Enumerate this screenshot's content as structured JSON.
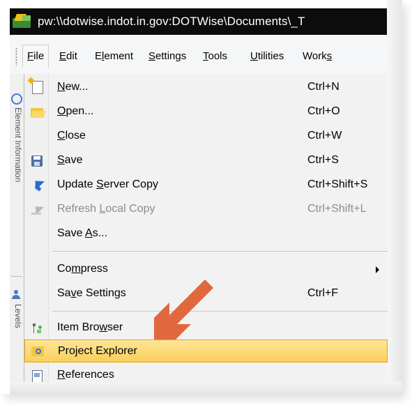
{
  "window": {
    "title": "pw:\\\\dotwise.indot.in.gov:DOTWise\\Documents\\_T"
  },
  "menubar": {
    "items": [
      {
        "label": "File",
        "mnemonic_index": 0
      },
      {
        "label": "Edit",
        "mnemonic_index": 0
      },
      {
        "label": "Element",
        "mnemonic_index": 1
      },
      {
        "label": "Settings",
        "mnemonic_index": 0
      },
      {
        "label": "Tools",
        "mnemonic_index": 0
      },
      {
        "label": "Utilities",
        "mnemonic_index": 0
      },
      {
        "label": "Works",
        "mnemonic_index": 4
      }
    ],
    "active": "File"
  },
  "sidepanel": {
    "text_top": "Element Information",
    "text_bottom": "Levels"
  },
  "file_menu": {
    "items": [
      {
        "label": "New...",
        "mnemonic": "N",
        "shortcut": "Ctrl+N",
        "icon": "new-file-icon"
      },
      {
        "label": "Open...",
        "mnemonic": "O",
        "shortcut": "Ctrl+O",
        "icon": "open-folder-icon"
      },
      {
        "label": "Close",
        "mnemonic": "C",
        "shortcut": "Ctrl+W",
        "icon": ""
      },
      {
        "label": "Save",
        "mnemonic": "S",
        "shortcut": "Ctrl+S",
        "icon": "save-disk-icon"
      },
      {
        "label": "Update Server Copy",
        "mnemonic": "S",
        "shortcut": "Ctrl+Shift+S",
        "icon": "update-arrow-icon"
      },
      {
        "label": "Refresh Local Copy",
        "mnemonic": "L",
        "shortcut": "Ctrl+Shift+L",
        "icon": "refresh-arrow-icon",
        "disabled": true
      },
      {
        "label": "Save As...",
        "mnemonic": "A",
        "shortcut": "",
        "icon": ""
      },
      {
        "label": "Compress",
        "mnemonic": "m",
        "shortcut": "",
        "submenu": true
      },
      {
        "label": "Save Settings",
        "mnemonic": "v",
        "shortcut": "Ctrl+F"
      },
      {
        "label": "Item Browser",
        "mnemonic": "w",
        "shortcut": "",
        "icon": "item-browser-icon"
      },
      {
        "label": "Project Explorer",
        "mnemonic": "j",
        "shortcut": "",
        "icon": "project-explorer-icon",
        "highlighted": true
      },
      {
        "label": "References",
        "mnemonic": "R",
        "shortcut": "",
        "icon": "references-icon"
      }
    ]
  },
  "colors": {
    "highlight_top": "#fde69a",
    "highlight_bottom": "#f9cf5a",
    "highlight_border": "#e5a51a",
    "annotation_arrow": "#e0683f",
    "titlebar": "#0c0c0c"
  }
}
